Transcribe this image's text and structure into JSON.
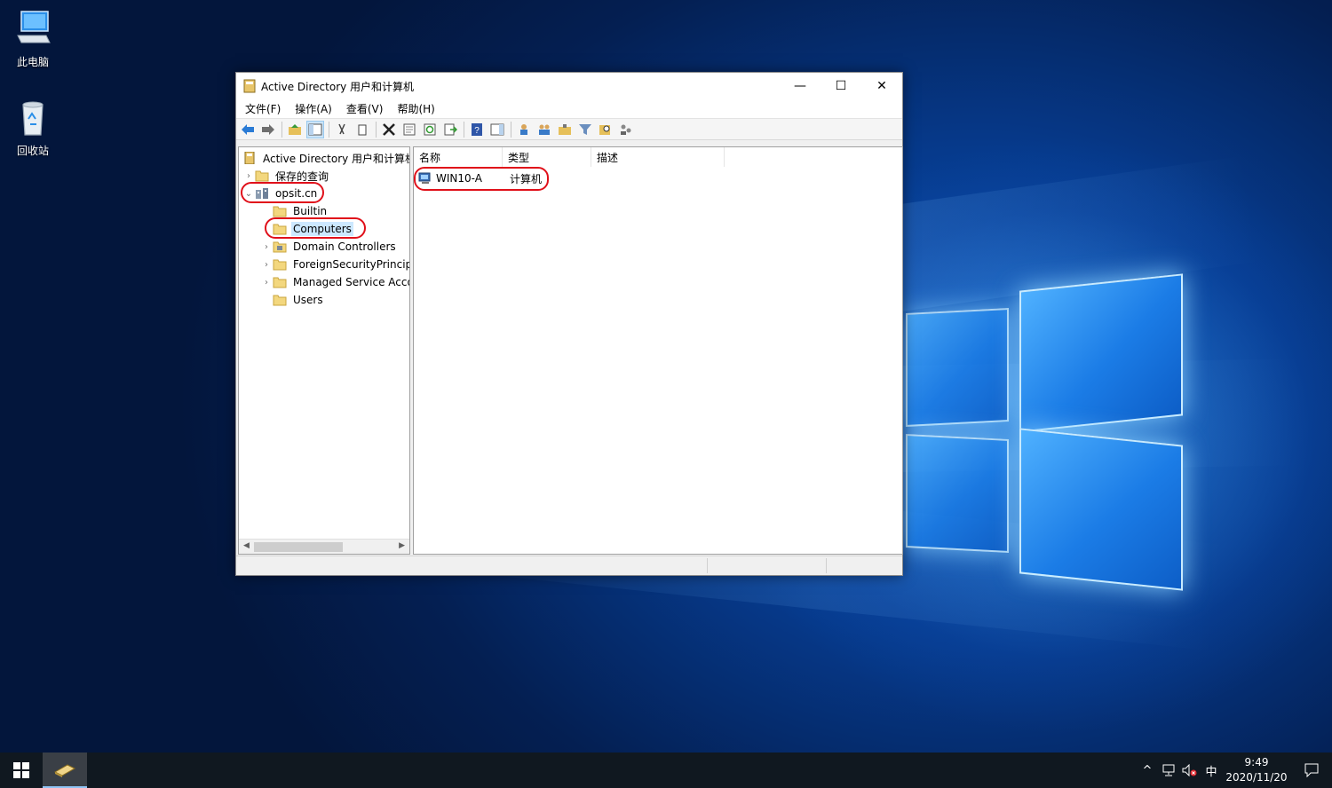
{
  "desktop": {
    "icons": [
      {
        "label": "此电脑",
        "icon": "computer-icon"
      },
      {
        "label": "回收站",
        "icon": "recycle-bin-icon"
      }
    ]
  },
  "window": {
    "title": "Active Directory 用户和计算机",
    "controls": {
      "minimize": "—",
      "maximize": "☐",
      "close": "✕"
    },
    "menu": [
      "文件(F)",
      "操作(A)",
      "查看(V)",
      "帮助(H)"
    ],
    "toolbar_icons": [
      "back-arrow-icon",
      "forward-arrow-icon",
      "up-folder-icon",
      "show-hide-tree-icon",
      "cut-icon",
      "copy-icon",
      "delete-icon",
      "properties-icon",
      "refresh-icon",
      "export-list-icon",
      "help-icon",
      "show-action-pane-icon",
      "new-user-icon",
      "new-group-icon",
      "new-ou-icon",
      "filter-icon",
      "find-icon",
      "add-to-group-icon"
    ]
  },
  "tree": {
    "root": "Active Directory 用户和计算机",
    "saved_queries": "保存的查询",
    "domain": "opsit.cn",
    "children": [
      {
        "label": "Builtin",
        "expandable": false
      },
      {
        "label": "Computers",
        "expandable": false,
        "selected": true
      },
      {
        "label": "Domain Controllers",
        "expandable": true
      },
      {
        "label": "ForeignSecurityPrincipals",
        "expandable": true
      },
      {
        "label": "Managed Service Accounts",
        "expandable": true
      },
      {
        "label": "Users",
        "expandable": false
      }
    ]
  },
  "list": {
    "columns": [
      "名称",
      "类型",
      "描述"
    ],
    "rows": [
      {
        "name": "WIN10-A",
        "type": "计算机",
        "description": ""
      }
    ]
  },
  "taskbar": {
    "tray": {
      "chevron": "^",
      "ime": "中"
    },
    "clock": {
      "time": "9:49",
      "date": "2020/11/20"
    }
  },
  "colors": {
    "highlight_ring": "#e0101a",
    "selection": "#cce8ff",
    "taskbar": "#101820"
  }
}
